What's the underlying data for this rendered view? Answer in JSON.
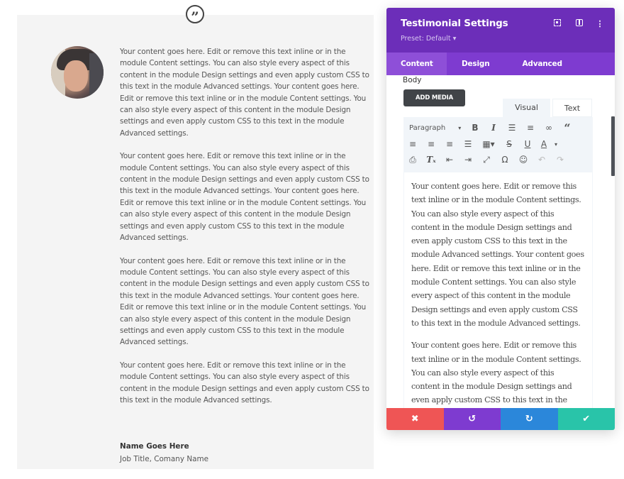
{
  "testimonial": {
    "paragraphs": [
      "Your content goes here. Edit or remove this text inline or in the module Content settings. You can also style every aspect of this content in the module Design settings and even apply custom CSS to this text in the module Advanced settings. Your content goes here. Edit or remove this text inline or in the module Content settings. You can also style every aspect of this content in the module Design settings and even apply custom CSS to this text in the module Advanced settings.",
      "Your content goes here. Edit or remove this text inline or in the module Content settings. You can also style every aspect of this content in the module Design settings and even apply custom CSS to this text in the module Advanced settings. Your content goes here. Edit or remove this text inline or in the module Content settings. You can also style every aspect of this content in the module Design settings and even apply custom CSS to this text in the module Advanced settings.",
      "Your content goes here. Edit or remove this text inline or in the module Content settings. You can also style every aspect of this content in the module Design settings and even apply custom CSS to this text in the module Advanced settings. Your content goes here. Edit or remove this text inline or in the module Content settings. You can also style every aspect of this content in the module Design settings and even apply custom CSS to this text in the module Advanced settings.",
      "Your content goes here. Edit or remove this text inline or in the module Content settings. You can also style every aspect of this content in the module Design settings and even apply custom CSS to this text in the module Advanced settings."
    ],
    "author_name": "Name Goes Here",
    "author_title": "Job Title, Comany Name",
    "quote_icon": "quote-icon",
    "quote_glyph": "”"
  },
  "panel": {
    "title": "Testimonial Settings",
    "preset": "Preset: Default ▾",
    "header_icons": [
      "fullscreen-icon",
      "columns-icon",
      "more-icon"
    ],
    "more_glyph": "⋮",
    "tabs": [
      {
        "label": "Content",
        "active": true
      },
      {
        "label": "Design",
        "active": false
      },
      {
        "label": "Advanced",
        "active": false
      }
    ],
    "body_label": "Body",
    "add_media": "ADD MEDIA",
    "editor_tabs": {
      "visual": "Visual",
      "text": "Text"
    },
    "toolbar": {
      "format_select": "Paragraph",
      "caret": "▾",
      "row1": [
        {
          "name": "bold-icon",
          "glyph": "B"
        },
        {
          "name": "italic-icon",
          "glyph": "I"
        },
        {
          "name": "bullet-list-icon",
          "glyph": "☰"
        },
        {
          "name": "numbered-list-icon",
          "glyph": "≡"
        },
        {
          "name": "link-icon",
          "glyph": "∞"
        },
        {
          "name": "blockquote-icon",
          "glyph": "“"
        }
      ],
      "row2": [
        {
          "name": "align-left-icon",
          "glyph": "≡"
        },
        {
          "name": "align-center-icon",
          "glyph": "≡"
        },
        {
          "name": "align-right-icon",
          "glyph": "≡"
        },
        {
          "name": "align-justify-icon",
          "glyph": "☰"
        },
        {
          "name": "table-icon",
          "glyph": "▦▾"
        },
        {
          "name": "strikethrough-icon",
          "glyph": "S"
        },
        {
          "name": "underline-icon",
          "glyph": "U"
        },
        {
          "name": "text-color-icon",
          "glyph": "A"
        },
        {
          "name": "text-color-dropdown-icon",
          "glyph": "▾"
        }
      ],
      "row3": [
        {
          "name": "paste-text-icon",
          "glyph": "⎙"
        },
        {
          "name": "clear-format-icon",
          "glyph": "Tₓ"
        },
        {
          "name": "outdent-icon",
          "glyph": "⇤"
        },
        {
          "name": "indent-icon",
          "glyph": "⇥"
        },
        {
          "name": "fullscreen-editor-icon",
          "glyph": "⤢"
        },
        {
          "name": "special-char-icon",
          "glyph": "Ω"
        },
        {
          "name": "emoji-icon",
          "glyph": "☺"
        },
        {
          "name": "undo-icon",
          "glyph": "↶"
        },
        {
          "name": "redo-icon",
          "glyph": "↷"
        }
      ]
    },
    "editor_paragraphs": [
      "Your content goes here. Edit or remove this text inline or in the module Content settings. You can also style every aspect of this content in the module Design settings and even apply custom CSS to this text in the module Advanced settings. Your content goes here. Edit or remove this text inline or in the module Content settings. You can also style every aspect of this content in the module Design settings and even apply custom CSS to this text in the module Advanced settings.",
      "Your content goes here. Edit or remove this text inline or in the module Content settings. You can also style every aspect of this content in the module Design settings and even apply custom CSS to this text in the module Advanced settings."
    ],
    "footer": {
      "cancel": "✖",
      "undo": "↺",
      "redo": "↻",
      "save": "✔"
    },
    "colors": {
      "header": "#6c2eb9",
      "tabs": "#7e3bd0",
      "cancel": "#ef5555",
      "undo": "#7e3bd0",
      "redo": "#2b87da",
      "save": "#29c4a9"
    }
  }
}
